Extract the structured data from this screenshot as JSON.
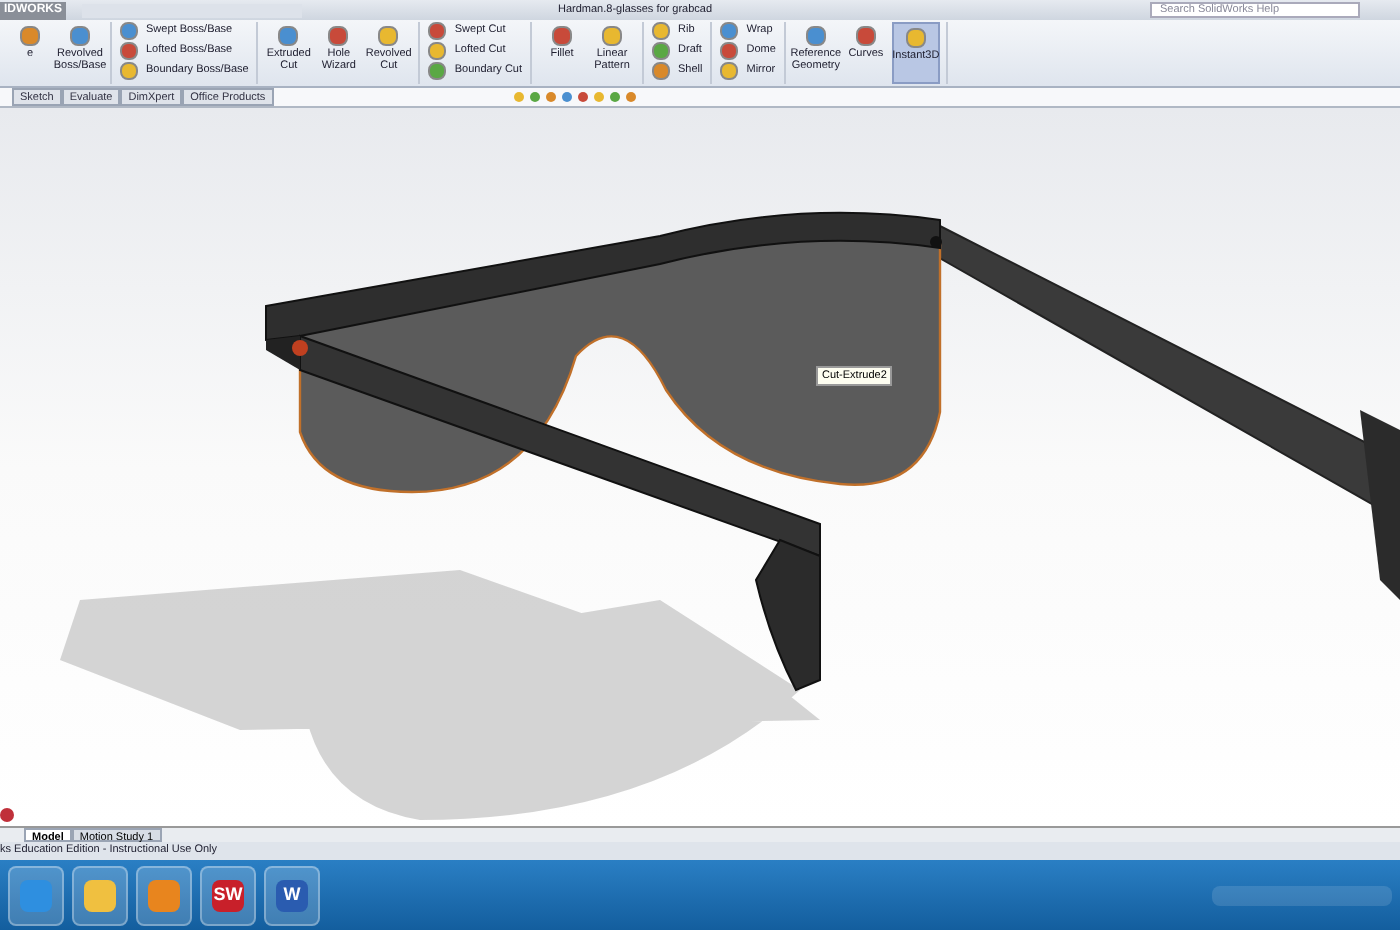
{
  "app": {
    "logo": "IDWORKS",
    "title": "Hardman.8-glasses for grabcad",
    "search": {
      "placeholder": "Search SolidWorks Help"
    }
  },
  "ribbon": [
    {
      "items": [
        {
          "kind": "large",
          "label": "e"
        },
        {
          "kind": "large",
          "label": "Revolved Boss/Base"
        }
      ]
    },
    {
      "items": [
        {
          "kind": "small",
          "label": "Swept Boss/Base"
        },
        {
          "kind": "small",
          "label": "Lofted Boss/Base"
        },
        {
          "kind": "small",
          "label": "Boundary Boss/Base"
        }
      ]
    },
    {
      "items": [
        {
          "kind": "large",
          "label": "Extruded Cut"
        },
        {
          "kind": "large",
          "label": "Hole Wizard"
        },
        {
          "kind": "large",
          "label": "Revolved Cut"
        }
      ]
    },
    {
      "items": [
        {
          "kind": "small",
          "label": "Swept Cut"
        },
        {
          "kind": "small",
          "label": "Lofted Cut"
        },
        {
          "kind": "small",
          "label": "Boundary Cut"
        }
      ]
    },
    {
      "items": [
        {
          "kind": "large",
          "label": "Fillet"
        },
        {
          "kind": "large",
          "label": "Linear Pattern"
        }
      ]
    },
    {
      "items": [
        {
          "kind": "small",
          "label": "Rib"
        },
        {
          "kind": "small",
          "label": "Draft"
        },
        {
          "kind": "small",
          "label": "Shell"
        }
      ]
    },
    {
      "items": [
        {
          "kind": "small",
          "label": "Wrap"
        },
        {
          "kind": "small",
          "label": "Dome"
        },
        {
          "kind": "small",
          "label": "Mirror"
        }
      ]
    },
    {
      "items": [
        {
          "kind": "large",
          "label": "Reference Geometry"
        },
        {
          "kind": "large",
          "label": "Curves"
        },
        {
          "kind": "active",
          "label": "Instant3D"
        }
      ]
    }
  ],
  "tabs": [
    {
      "label": "Sketch",
      "selected": false
    },
    {
      "label": "Evaluate",
      "selected": false
    },
    {
      "label": "DimXpert",
      "selected": false
    },
    {
      "label": "Office Products",
      "selected": false
    }
  ],
  "viewport": {
    "tooltip": "Cut-Extrude2"
  },
  "bottom_tabs": [
    {
      "label": "Model",
      "selected": true
    },
    {
      "label": "Motion Study 1",
      "selected": false
    }
  ],
  "status_bar": {
    "text": "ks Education Edition - Instructional Use Only"
  },
  "taskbar": {
    "apps": [
      {
        "kind": "ie"
      },
      {
        "kind": "folder"
      },
      {
        "kind": "media"
      },
      {
        "label": "SW",
        "kind": "sw"
      },
      {
        "label": "W",
        "kind": "word"
      }
    ]
  }
}
